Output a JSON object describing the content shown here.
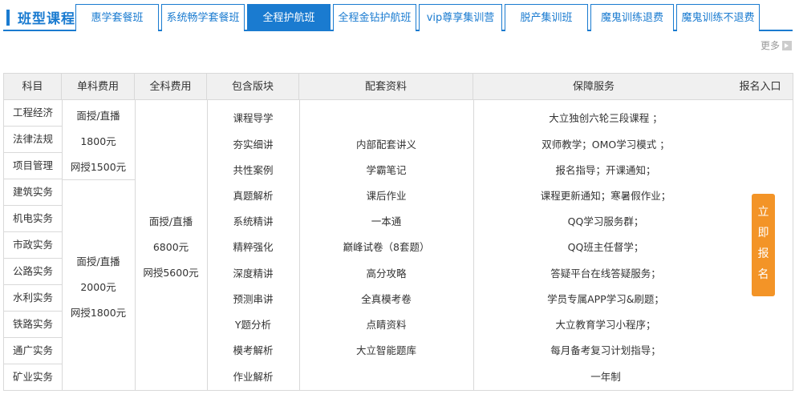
{
  "header": {
    "title": "班型课程",
    "tabs": [
      {
        "label": "惠学套餐班",
        "active": false
      },
      {
        "label": "系统畅学套餐班",
        "active": false
      },
      {
        "label": "全程护航班",
        "active": true
      },
      {
        "label": "全程金钻护航班",
        "active": false
      },
      {
        "label": "vip尊享集训营",
        "active": false
      },
      {
        "label": "脱产集训班",
        "active": false
      },
      {
        "label": "魔鬼训练退费",
        "active": false
      },
      {
        "label": "魔鬼训练不退费",
        "active": false
      }
    ],
    "more": "更多"
  },
  "table": {
    "headers": [
      "科目",
      "单科费用",
      "全科费用",
      "包含版块",
      "配套资料",
      "保障服务",
      "报名入口"
    ],
    "subjects": [
      "工程经济",
      "法律法规",
      "项目管理",
      "建筑实务",
      "机电实务",
      "市政实务",
      "公路实务",
      "水利实务",
      "铁路实务",
      "通广实务",
      "矿业实务"
    ],
    "single_fee_group1": [
      "面授/直播",
      "1800元",
      "网授1500元"
    ],
    "single_fee_group2": [
      "面授/直播",
      "2000元",
      "网授1800元"
    ],
    "full_fee": [
      "面授/直播",
      "6800元",
      "网授5600元"
    ],
    "modules": [
      "课程导学",
      "夯实细讲",
      "共性案例",
      "真题解析",
      "系统精讲",
      "精粹强化",
      "深度精讲",
      "预测串讲",
      "Y题分析",
      "模考解析",
      "作业解析"
    ],
    "materials": [
      "内部配套讲义",
      "学霸笔记",
      "课后作业",
      "一本通",
      "巅峰试卷（8套题）",
      "高分攻略",
      "全真模考卷",
      "点睛资料",
      "大立智能题库"
    ],
    "services": [
      "大立独创六轮三段课程 ；",
      "双师教学；OMO学习模式 ；",
      "报名指导；开课通知；",
      "课程更新通知；寒暑假作业；",
      "QQ学习服务群；",
      "QQ班主任督学；",
      "答疑平台在线答疑服务；",
      "学员专属APP学习&刷题；",
      "大立教育学习小程序；",
      "每月备考复习计划指导；",
      "一年制"
    ],
    "signup_chars": [
      "立",
      "即",
      "报",
      "名"
    ]
  },
  "colors": {
    "accent": "#1a7bd0",
    "signup": "#f39427",
    "header_bg": "#f0f0f0",
    "border": "#d9d9d9"
  }
}
